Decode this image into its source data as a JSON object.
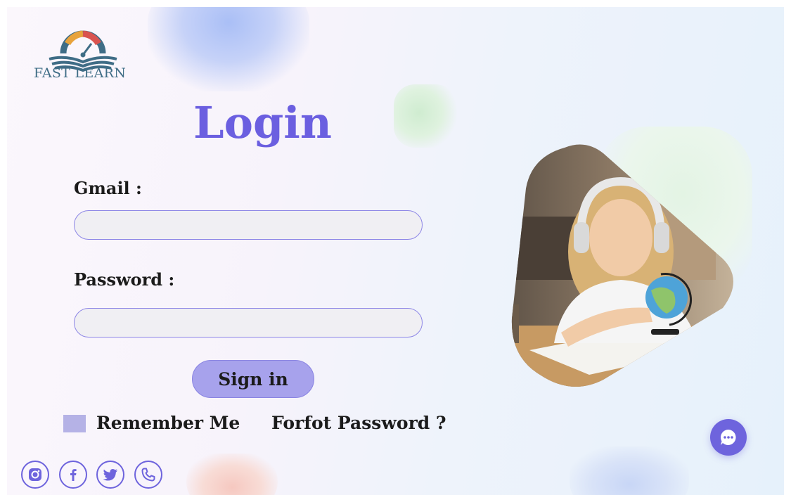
{
  "brand": {
    "name": "FAST LEARN"
  },
  "page": {
    "title": "Login"
  },
  "form": {
    "gmail_label": "Gmail :",
    "gmail_value": "",
    "password_label": "Password :",
    "password_value": "",
    "signin_label": "Sign in",
    "remember_label": "Remember Me",
    "forgot_label": "Forfot Password ?"
  },
  "social": [
    "instagram-icon",
    "facebook-icon",
    "twitter-icon",
    "phone-icon"
  ],
  "colors": {
    "accent": "#6b5fe0",
    "button": "#a7a2ec",
    "checkbox": "#b5b2e6",
    "logo_text": "#3f6d86"
  }
}
